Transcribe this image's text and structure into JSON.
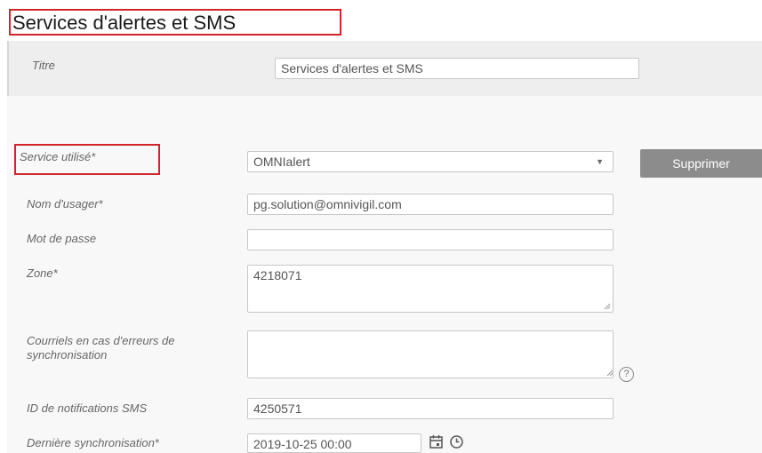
{
  "page_title": "Services d'alertes et SMS",
  "header": {
    "title_label": "Titre",
    "title_value": "Services d'alertes et SMS"
  },
  "form": {
    "service": {
      "label": "Service utilisé*",
      "value": "OMNIalert"
    },
    "delete_button": "Supprimer",
    "username": {
      "label": "Nom d'usager*",
      "value": "pg.solution@omnivigil.com"
    },
    "password": {
      "label": "Mot de passe",
      "value": ""
    },
    "zone": {
      "label": "Zone*",
      "value": "4218071"
    },
    "sync_error_emails": {
      "label": "Courriels en cas d'erreurs de synchronisation",
      "value": "",
      "help": "?"
    },
    "sms_notification_id": {
      "label": "ID de notifications SMS",
      "value": "4250571"
    },
    "last_sync": {
      "label": "Dernière synchronisation*",
      "value": "2019-10-25 00:00"
    }
  },
  "colors": {
    "highlight": "#d0262a",
    "button": "#8c8c8c"
  },
  "icons": [
    "dropdown-arrow-icon",
    "calendar-icon",
    "clock-icon",
    "help-icon",
    "resize-grip-icon"
  ]
}
